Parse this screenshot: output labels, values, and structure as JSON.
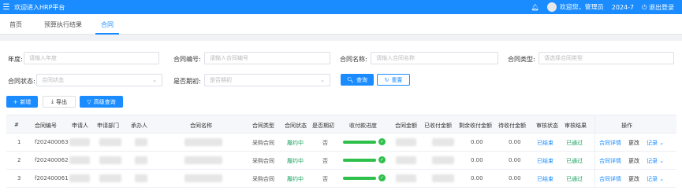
{
  "topbar": {
    "menu_icon": "menu-icon",
    "title": "欢迎进入HRP平台",
    "bell_icon": "bell-icon",
    "welcome": "欢迎您，管理员",
    "date": "2024-7",
    "logout": "退出登录",
    "accent": "#1a8cff"
  },
  "tabs": [
    {
      "label": "首页"
    },
    {
      "label": "预算执行结果"
    },
    {
      "label": "合同"
    }
  ],
  "filters": {
    "year": {
      "label": "年度:",
      "placeholder": "请输入年度"
    },
    "contract_no": {
      "label": "合同编号:",
      "placeholder": "请输入合同编号"
    },
    "contract_name": {
      "label": "合同名称:",
      "placeholder": "请输入合同名称"
    },
    "contract_type": {
      "label": "合同类型:",
      "placeholder": "请选择合同类型"
    },
    "contract_status": {
      "label": "合同状态:",
      "placeholder": "合同状态"
    },
    "is_initial": {
      "label": "是否期初:",
      "placeholder": "是否期初"
    },
    "search": "查询",
    "reset": "重置"
  },
  "toolbar": {
    "add": "新增",
    "export": "导出",
    "advanced": "高级查询"
  },
  "table": {
    "headers": [
      "#",
      "合同编号",
      "申请人",
      "申请部门",
      "承办人",
      "合同名称",
      "合同类型",
      "合同状态",
      "是否期初",
      "收付款进度",
      "合同金额",
      "已收付金额",
      "剩余收付金额",
      "待收付金额",
      "审核状态",
      "审核结果",
      "操作"
    ],
    "rows": [
      {
        "index": "1",
        "no": "f202400063",
        "type": "采购合同",
        "status": "履约中",
        "initial": "否",
        "progress": 1.0,
        "remaining": "0.00",
        "pending": "0.00",
        "audit_status": "已结束",
        "audit_result": "已通过",
        "detail": "合同详情",
        "edit": "更改",
        "records": "记录"
      },
      {
        "index": "2",
        "no": "f202400062",
        "type": "采购合同",
        "status": "履约中",
        "initial": "否",
        "progress": 1.0,
        "remaining": "0.00",
        "pending": "0.00",
        "audit_status": "已结束",
        "audit_result": "已通过",
        "detail": "合同详情",
        "edit": "更改",
        "records": "记录"
      },
      {
        "index": "3",
        "no": "f202400061",
        "type": "采购合同",
        "status": "履约中",
        "initial": "否",
        "progress": 1.0,
        "remaining": "0.00",
        "pending": "0.00",
        "audit_status": "已结束",
        "audit_result": "已通过",
        "detail": "合同详情",
        "edit": "更改",
        "records": "记录"
      }
    ]
  }
}
